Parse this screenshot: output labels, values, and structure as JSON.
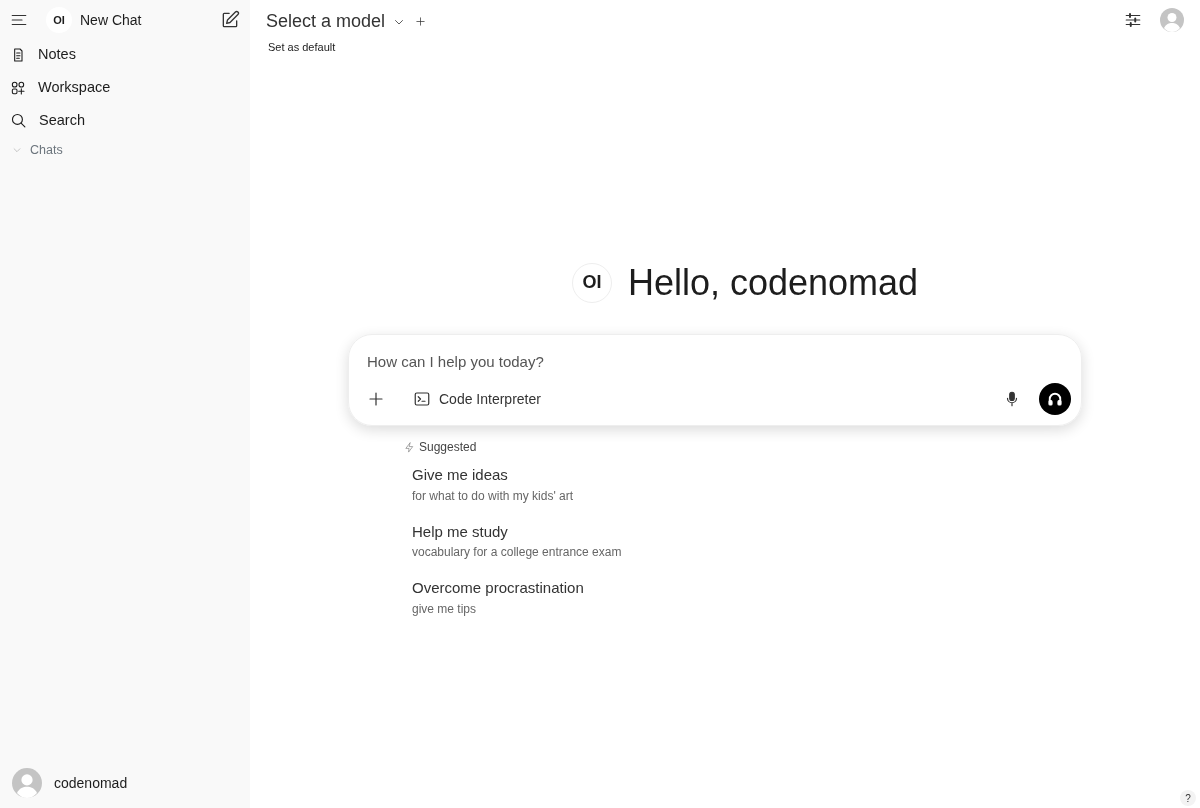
{
  "sidebar": {
    "logo": "OI",
    "new_chat": "New Chat",
    "items": [
      {
        "kind": "notes",
        "label": "Notes"
      },
      {
        "kind": "workspace",
        "label": "Workspace"
      },
      {
        "kind": "search",
        "label": "Search"
      }
    ],
    "chats": {
      "label": "Chats",
      "expanded": true
    },
    "user": "codenomad"
  },
  "header": {
    "model_select": "Select a model",
    "set_default": "Set as default"
  },
  "greeting": {
    "logo": "OI",
    "text": "Hello, codenomad"
  },
  "composer": {
    "placeholder": "How can I help you today?",
    "tools": [
      {
        "label": "Code Interpreter"
      }
    ]
  },
  "suggested": {
    "label": "Suggested",
    "items": [
      {
        "title": "Give me ideas",
        "subtitle": "for what to do with my kids' art"
      },
      {
        "title": "Help me study",
        "subtitle": "vocabulary for a college entrance exam"
      },
      {
        "title": "Overcome procrastination",
        "subtitle": "give me tips"
      }
    ]
  },
  "help": "?"
}
